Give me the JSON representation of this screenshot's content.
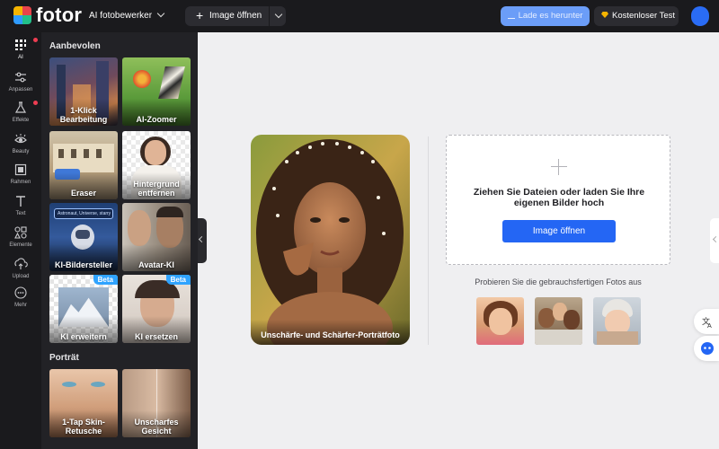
{
  "header": {
    "brand": "fotor",
    "app_menu": "AI fotobewerker",
    "open_image": "Image öffnen",
    "download": "Lade es herunter",
    "trial": "Kostenloser Test"
  },
  "rail": {
    "items": [
      {
        "label": "AI",
        "icon": "ai-grid-icon"
      },
      {
        "label": "Anpassen",
        "icon": "sliders-icon"
      },
      {
        "label": "Effekte",
        "icon": "flask-icon"
      },
      {
        "label": "Beauty",
        "icon": "eye-icon"
      },
      {
        "label": "Rahmen",
        "icon": "frame-icon"
      },
      {
        "label": "Text",
        "icon": "text-icon"
      },
      {
        "label": "Elemente",
        "icon": "shapes-icon"
      },
      {
        "label": "Upload",
        "icon": "upload-icon"
      },
      {
        "label": "Mehr",
        "icon": "more-icon"
      }
    ]
  },
  "panel": {
    "section_recommended": "Aanbevolen",
    "tiles": [
      {
        "label": "1-Klick Bearbeitung"
      },
      {
        "label": "AI-Zoomer"
      },
      {
        "label": "Eraser"
      },
      {
        "label": "Hintergrund entfernen"
      },
      {
        "label": "KI-Bildersteller",
        "prompt": "Astronaut, Universe, starry"
      },
      {
        "label": "Avatar-KI"
      },
      {
        "label": "KI erweitern",
        "badge": "Beta"
      },
      {
        "label": "KI ersetzen",
        "badge": "Beta"
      }
    ],
    "section_portrait": "Porträt",
    "portrait_tiles": [
      {
        "label": "1-Tap Skin-Retusche"
      },
      {
        "label": "Unscharfes Gesicht"
      }
    ]
  },
  "main": {
    "hero_caption": "Unschärfe- und Schärfer-Porträtfoto",
    "dropzone_text": "Ziehen Sie Dateien oder laden Sie Ihre eigenen Bilder hoch",
    "dropzone_button": "Image öffnen",
    "try_text": "Probieren Sie die gebrauchsfertigen Fotos aus"
  },
  "colors": {
    "primary": "#2466f4",
    "dark_bg": "#1a1a1d",
    "panel_bg": "#222226",
    "canvas_bg": "#efeff1"
  }
}
